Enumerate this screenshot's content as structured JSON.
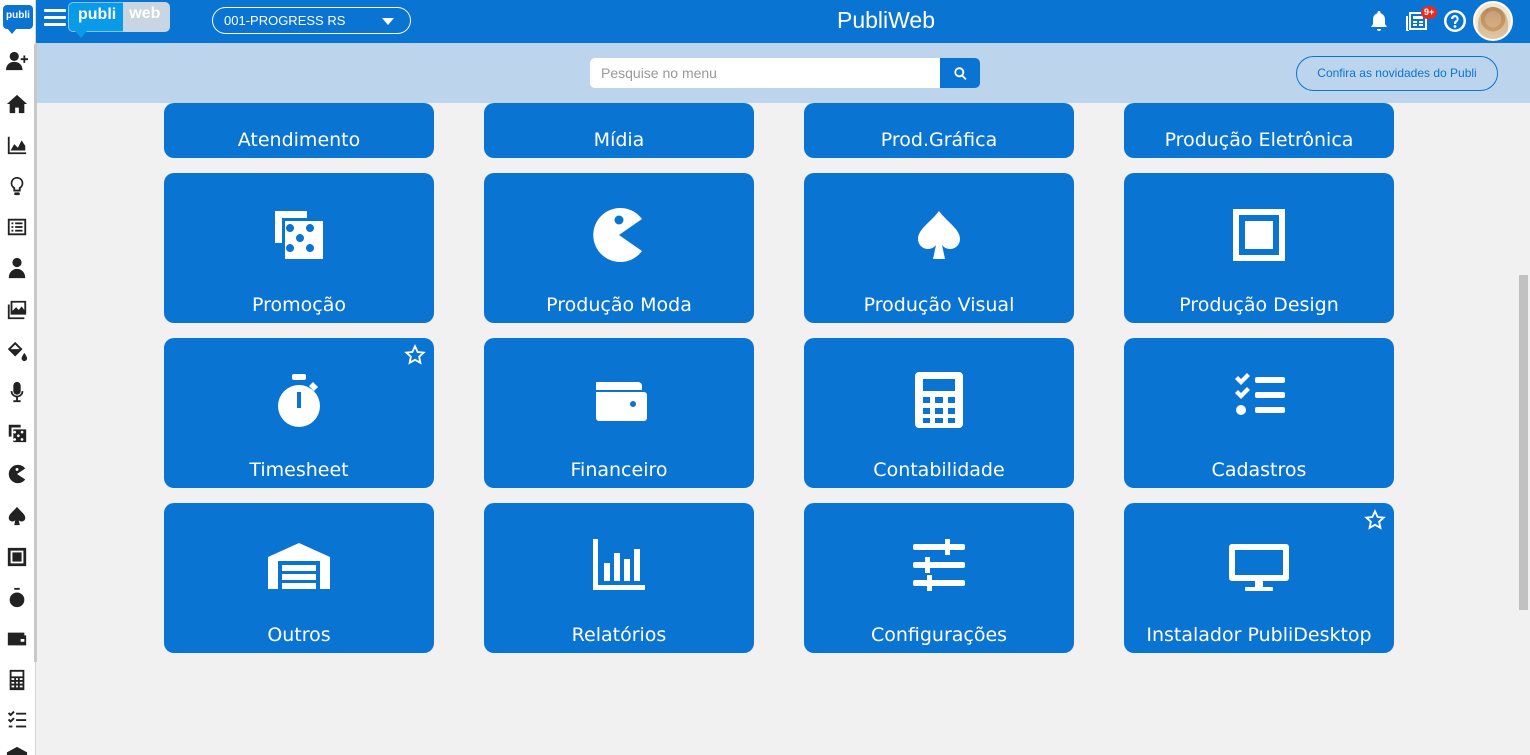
{
  "sidebar": {
    "logo_text": "publi",
    "items": [
      {
        "icon": "user-plus-icon"
      },
      {
        "icon": "home-icon"
      },
      {
        "icon": "area-chart-icon"
      },
      {
        "icon": "lightbulb-icon"
      },
      {
        "icon": "list-icon"
      },
      {
        "icon": "user-tie-icon"
      },
      {
        "icon": "images-icon"
      },
      {
        "icon": "paint-bucket-icon"
      },
      {
        "icon": "microphone-icon"
      },
      {
        "icon": "dice-icon"
      },
      {
        "icon": "pacman-icon"
      },
      {
        "icon": "spade-icon"
      },
      {
        "icon": "square-icon"
      },
      {
        "icon": "stopwatch-icon"
      },
      {
        "icon": "wallet-icon"
      },
      {
        "icon": "calculator-icon"
      },
      {
        "icon": "checklist-icon"
      },
      {
        "icon": "warehouse-icon"
      }
    ]
  },
  "topbar": {
    "brand_part1": "publi",
    "brand_part2": "web",
    "company_selected": "001-PROGRESS RS",
    "title": "PubliWeb",
    "notification_badge": "9+"
  },
  "search": {
    "placeholder": "Pesquise no menu",
    "news_button": "Confira as novidades do Publi"
  },
  "tiles": {
    "row0": [
      "Atendimento",
      "Mídia",
      "Prod.Gráfica",
      "Produção Eletrônica"
    ],
    "promocao": "Promoção",
    "producao_moda": "Produção Moda",
    "producao_visual": "Produção Visual",
    "producao_design": "Produção Design",
    "timesheet": "Timesheet",
    "financeiro": "Financeiro",
    "contabilidade": "Contabilidade",
    "cadastros": "Cadastros",
    "outros": "Outros",
    "relatorios": "Relatórios",
    "configuracoes": "Configurações",
    "instalador": "Instalador PubliDesktop"
  },
  "colors": {
    "primary": "#0a74d3",
    "search_band": "#bdd5ec",
    "background": "#f1f1f1",
    "badge": "#e52d27"
  }
}
